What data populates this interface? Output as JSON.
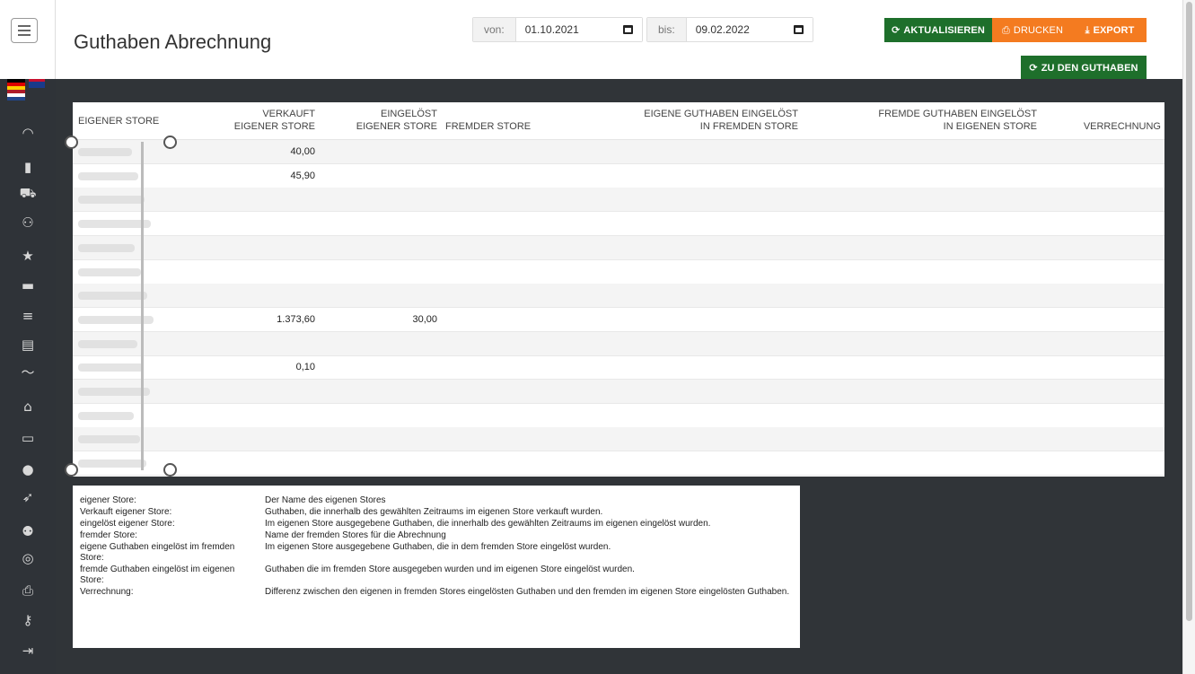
{
  "header": {
    "title": "Guthaben Abrechnung",
    "from_label": "von:",
    "from_value": "01.10.2021",
    "to_label": "bis:",
    "to_value": "09.02.2022",
    "refresh_label": "AKTUALISIEREN",
    "print_label": "DRUCKEN",
    "export_label": "EXPORT",
    "to_credits_label": "ZU DEN GUTHABEN"
  },
  "colors": {
    "accent_green": "#1e6f2b",
    "accent_orange": "#f47b20",
    "sidebar_bg": "#2f3338"
  },
  "sidebar": {
    "icons": [
      "menu-icon",
      "flag-de-icon",
      "flag-uk-icon",
      "flag-nl-icon",
      "dashboard-icon",
      "chart-icon",
      "cart-icon",
      "add-user-icon",
      "star-icon",
      "archive-icon",
      "list-icon",
      "book-icon",
      "trend-icon",
      "home-icon",
      "monitor-icon",
      "user-icon",
      "rocket-icon",
      "users-icon",
      "database-icon",
      "print-icon",
      "key-icon",
      "logout-icon"
    ]
  },
  "table": {
    "columns": [
      {
        "line1": "",
        "line2": "EIGENER STORE"
      },
      {
        "line1": "VERKAUFT",
        "line2": "EIGENER STORE"
      },
      {
        "line1": "EINGELÖST",
        "line2": "EIGENER STORE"
      },
      {
        "line1": "",
        "line2": "FREMDER STORE"
      },
      {
        "line1": "EIGENE GUTHABEN EINGELÖST",
        "line2": "IN FREMDEN STORE"
      },
      {
        "line1": "FREMDE GUTHABEN EINGELÖST",
        "line2": "IN EIGENEN STORE"
      },
      {
        "line1": "",
        "line2": "VERRECHNUNG"
      }
    ],
    "rows": [
      {
        "sold": "40,00",
        "redeemed": ""
      },
      {
        "sold": "45,90",
        "redeemed": ""
      },
      {
        "sold": "",
        "redeemed": ""
      },
      {
        "sold": "",
        "redeemed": ""
      },
      {
        "sold": "",
        "redeemed": ""
      },
      {
        "sold": "",
        "redeemed": ""
      },
      {
        "sold": "",
        "redeemed": ""
      },
      {
        "sold": "1.373,60",
        "redeemed": "30,00"
      },
      {
        "sold": "",
        "redeemed": ""
      },
      {
        "sold": "0,10",
        "redeemed": ""
      },
      {
        "sold": "",
        "redeemed": ""
      },
      {
        "sold": "",
        "redeemed": ""
      },
      {
        "sold": "",
        "redeemed": ""
      },
      {
        "sold": "",
        "redeemed": ""
      }
    ]
  },
  "legend": [
    {
      "term": "eigener Store:",
      "desc": "Der Name des eigenen Stores"
    },
    {
      "term": "Verkauft eigener Store:",
      "desc": "Guthaben, die innerhalb des gewählten Zeitraums im eigenen Store verkauft wurden."
    },
    {
      "term": "eingelöst eigener Store:",
      "desc": "Im eigenen Store ausgegebene Guthaben, die innerhalb des gewählten Zeitraums im eigenen eingelöst wurden."
    },
    {
      "term": "fremder Store:",
      "desc": "Name der fremden Stores für die Abrechnung"
    },
    {
      "term": "eigene Guthaben eingelöst im fremden Store:",
      "desc": "Im eigenen Store ausgegebene Guthaben, die in dem fremden Store eingelöst wurden."
    },
    {
      "term": "fremde Guthaben eingelöst im eigenen Store:",
      "desc": "Guthaben die im fremden Store ausgegeben wurden und im eigenen Store eingelöst wurden."
    },
    {
      "term": "Verrechnung:",
      "desc": "Differenz zwischen den eigenen in fremden Stores eingelösten Guthaben und den fremden im eigenen Store eingelösten Guthaben."
    }
  ]
}
